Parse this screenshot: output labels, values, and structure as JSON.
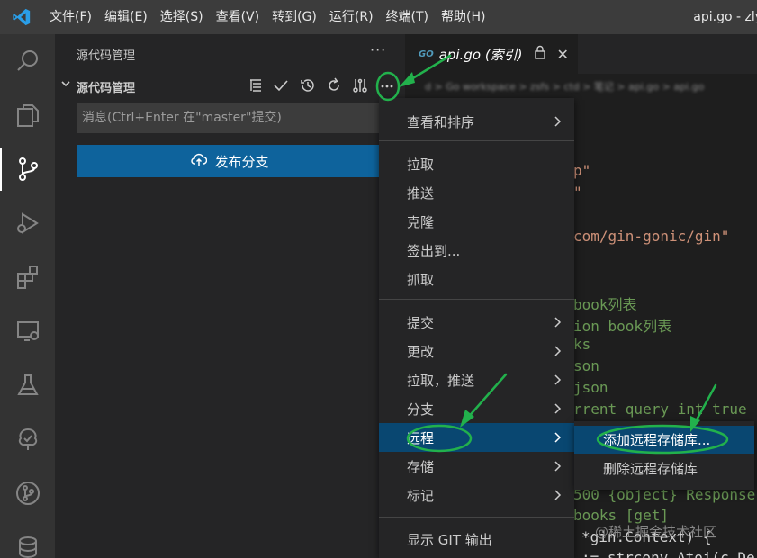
{
  "menubar": {
    "items": [
      "文件(F)",
      "编辑(E)",
      "选择(S)",
      "查看(V)",
      "转到(G)",
      "运行(R)",
      "终端(T)",
      "帮助(H)"
    ],
    "window_title": "api.go - zly"
  },
  "activitybar": {
    "items": [
      "search-icon",
      "explorer-icon",
      "source-control-icon",
      "run-debug-icon",
      "extensions-icon",
      "remote-explorer-icon",
      "testing-icon",
      "tree-icon",
      "git-graph-icon",
      "database-icon"
    ],
    "active": "source-control-icon"
  },
  "sidebar": {
    "title": "源代码管理",
    "more": "···",
    "section_label": "源代码管理",
    "message_placeholder": "消息(Ctrl+Enter 在\"master\"提交)",
    "publish_button": "发布分支"
  },
  "editor": {
    "tab_label": "api.go (索引)",
    "tab_badge": "GO",
    "breadcrumb": "d > Go workspace > zsfs > ctd > 笔记 > api.go > api.go",
    "code": {
      "line_p": "p\"",
      "line_quote": "\"",
      "line_gin": "com/gin-gonic/gin\"",
      "line_book_list": "book列表",
      "line_ion_book": "ion book列表",
      "line_ks": "ks",
      "line_son": "son",
      "line_json": "json",
      "line_query": "rrent query int true \"",
      "line_500": "500 {object} Response",
      "line_books_get": "books [get]",
      "line_gin_context": "*gin.Context) {",
      "line_strconv": ":= strconv.Atoi(c.De"
    },
    "watermark": "@稀土掘金技术社区"
  },
  "context_menu": {
    "group1": [
      {
        "label": "查看和排序",
        "submenu": true
      }
    ],
    "group2": [
      {
        "label": "拉取",
        "submenu": false
      },
      {
        "label": "推送",
        "submenu": false
      },
      {
        "label": "克隆",
        "submenu": false
      },
      {
        "label": "签出到...",
        "submenu": false
      },
      {
        "label": "抓取",
        "submenu": false
      }
    ],
    "group3": [
      {
        "label": "提交",
        "submenu": true
      },
      {
        "label": "更改",
        "submenu": true
      },
      {
        "label": "拉取，推送",
        "submenu": true
      },
      {
        "label": "分支",
        "submenu": true
      },
      {
        "label": "远程",
        "submenu": true,
        "selected": true
      },
      {
        "label": "存储",
        "submenu": true
      },
      {
        "label": "标记",
        "submenu": true
      }
    ],
    "group4": [
      {
        "label": "显示 GIT 输出",
        "submenu": false
      }
    ]
  },
  "submenu_remote": {
    "items": [
      {
        "label": "添加远程存储库...",
        "selected": true
      },
      {
        "label": "删除远程存储库",
        "selected": false
      }
    ]
  },
  "colors": {
    "accent": "#0e639c",
    "selection": "#094771",
    "annotation": "#22b14c"
  }
}
